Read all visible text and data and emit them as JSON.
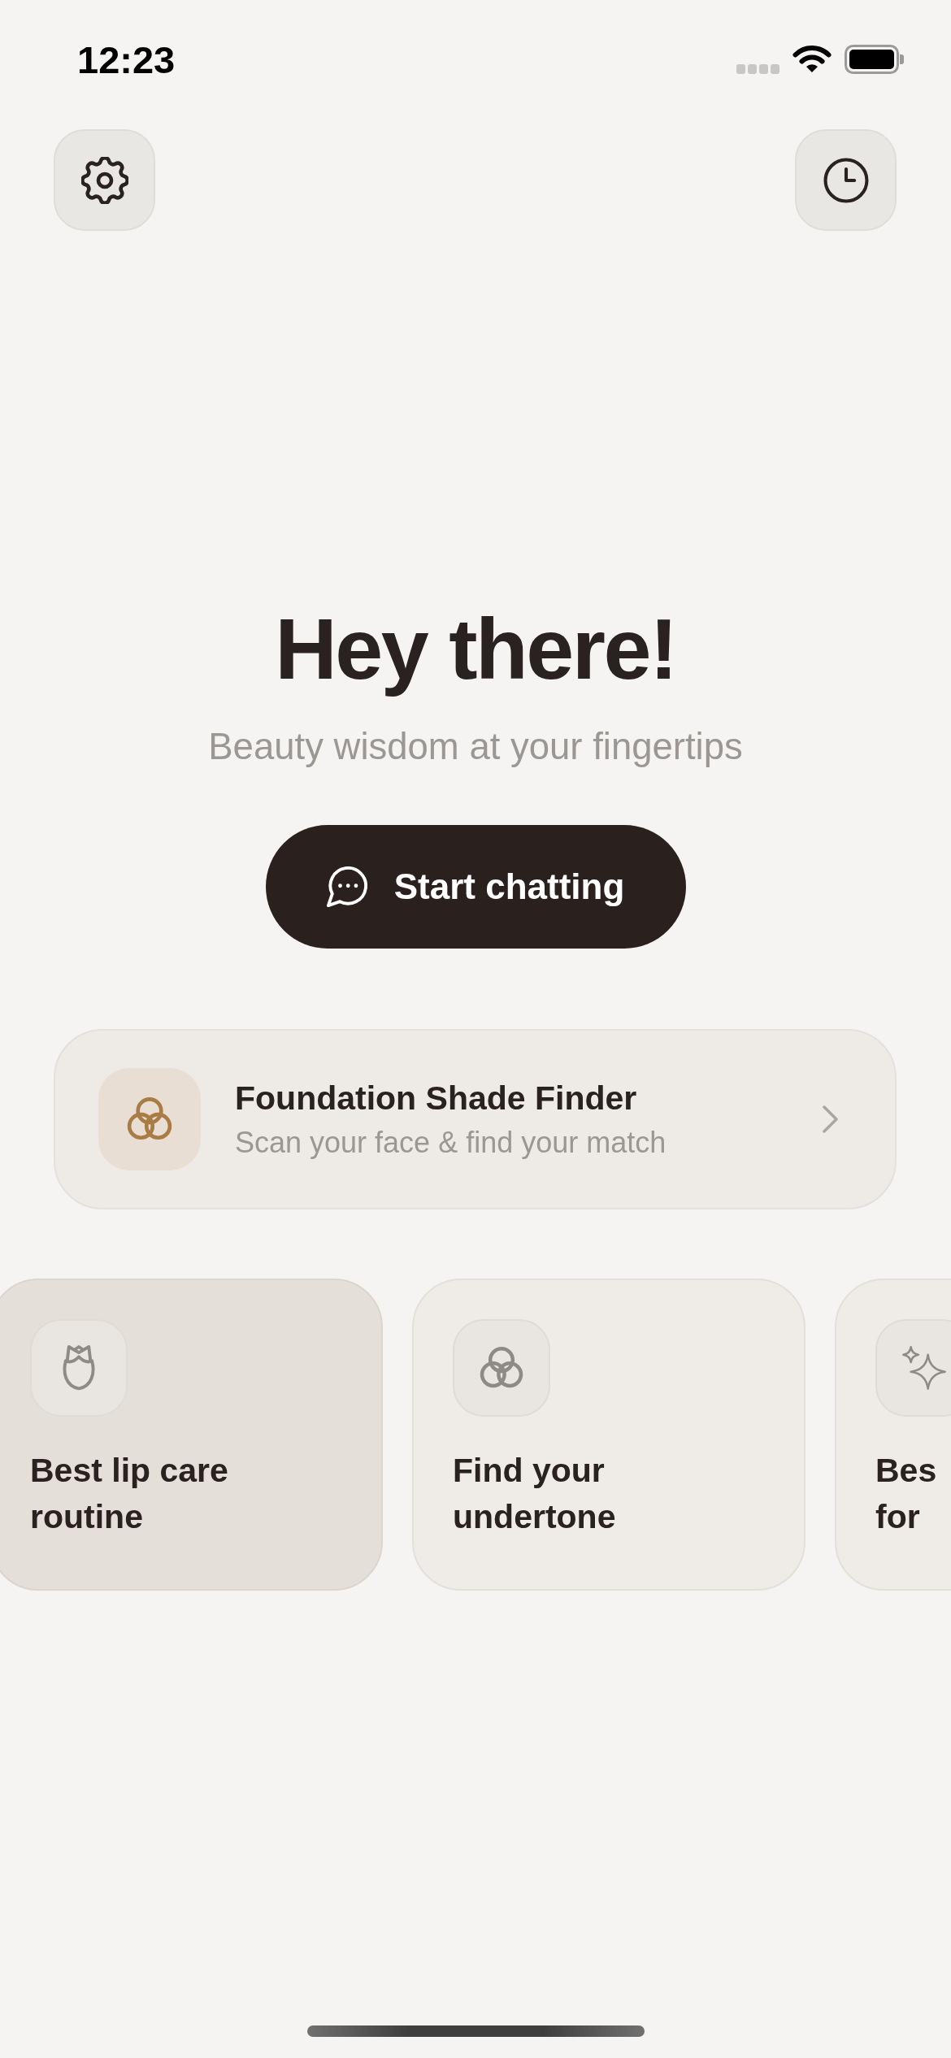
{
  "status_bar": {
    "time": "12:23"
  },
  "greeting": {
    "title": "Hey there!",
    "subtitle": "Beauty wisdom at your fingertips",
    "button": {
      "label": "Start chatting"
    }
  },
  "feature_card": {
    "title": "Foundation Shade Finder",
    "subtitle": "Scan your face & find your match"
  },
  "suggestions": [
    {
      "title": "Best lip care\nroutine",
      "selected": true
    },
    {
      "title": "Find your\nundertone",
      "selected": false
    },
    {
      "title": "Bes\nfor",
      "selected": false
    }
  ]
}
